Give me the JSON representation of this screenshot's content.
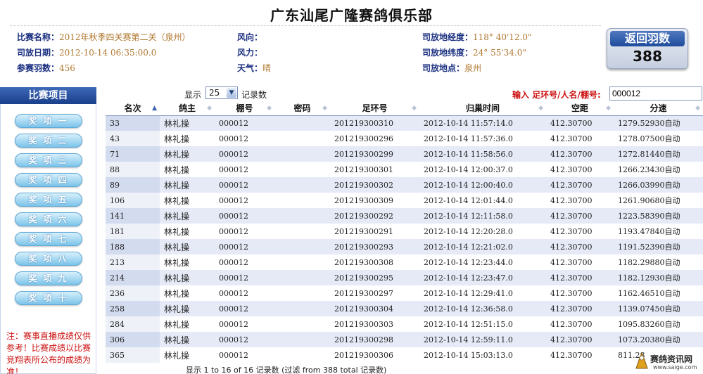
{
  "title": "广东汕尾广隆赛鸽俱乐部",
  "info": {
    "race_name_label": "比赛名称：",
    "race_name": "2012年秋季四关赛第二关（泉州）",
    "release_date_label": "司放日期：",
    "release_date": "2012-10-14 06:35:00.0",
    "entries_label": "参赛羽数：",
    "entries": "456",
    "wind_dir_label": "风向：",
    "wind_dir": "",
    "wind_force_label": "风力：",
    "wind_force": "",
    "weather_label": "天气：",
    "weather": "晴",
    "longitude_label": "司放地经度：",
    "longitude": "118° 40'12.0\"",
    "latitude_label": "司放地纬度：",
    "latitude": "24° 55'34.0\"",
    "location_label": "司放地点：",
    "location": "泉州"
  },
  "return_box": {
    "label": "返回羽数",
    "count": "388"
  },
  "sidebar": {
    "title": "比赛项目",
    "buttons": [
      "奖项一",
      "奖项二",
      "奖项三",
      "奖项四",
      "奖项五",
      "奖项六",
      "奖项七",
      "奖项八",
      "奖项九",
      "奖项十"
    ],
    "note": "注：赛事直播成绩仅供参考！比赛成绩以比赛竞翔表所公布的成绩为准！"
  },
  "controls": {
    "show_label": "显示",
    "page_size": "25",
    "records_label": "记录数",
    "search_label": "输入 足环号/人名/棚号:",
    "search_value": "000012"
  },
  "table": {
    "columns": [
      "名次",
      "鸽主",
      "棚号",
      "密码",
      "足环号",
      "归巢时间",
      "空距",
      "分速"
    ],
    "rows": [
      [
        "33",
        "林礼操",
        "000012",
        "",
        "201219300310",
        "2012-10-14 11:57:14.0",
        "412.30700",
        "1279.52930自动"
      ],
      [
        "43",
        "林礼操",
        "000012",
        "",
        "201219300296",
        "2012-10-14 11:57:36.0",
        "412.30700",
        "1278.07500自动"
      ],
      [
        "71",
        "林礼操",
        "000012",
        "",
        "201219300299",
        "2012-10-14 11:58:56.0",
        "412.30700",
        "1272.81440自动"
      ],
      [
        "88",
        "林礼操",
        "000012",
        "",
        "201219300301",
        "2012-10-14 12:00:37.0",
        "412.30700",
        "1266.23430自动"
      ],
      [
        "89",
        "林礼操",
        "000012",
        "",
        "201219300302",
        "2012-10-14 12:00:40.0",
        "412.30700",
        "1266.03990自动"
      ],
      [
        "106",
        "林礼操",
        "000012",
        "",
        "201219300309",
        "2012-10-14 12:01:44.0",
        "412.30700",
        "1261.90680自动"
      ],
      [
        "141",
        "林礼操",
        "000012",
        "",
        "201219300292",
        "2012-10-14 12:11:58.0",
        "412.30700",
        "1223.58390自动"
      ],
      [
        "181",
        "林礼操",
        "000012",
        "",
        "201219300291",
        "2012-10-14 12:20:28.0",
        "412.30700",
        "1193.47840自动"
      ],
      [
        "188",
        "林礼操",
        "000012",
        "",
        "201219300293",
        "2012-10-14 12:21:02.0",
        "412.30700",
        "1191.52390自动"
      ],
      [
        "213",
        "林礼操",
        "000012",
        "",
        "201219300308",
        "2012-10-14 12:23:44.0",
        "412.30700",
        "1182.29880自动"
      ],
      [
        "214",
        "林礼操",
        "000012",
        "",
        "201219300295",
        "2012-10-14 12:23:47.0",
        "412.30700",
        "1182.12930自动"
      ],
      [
        "236",
        "林礼操",
        "000012",
        "",
        "201219300297",
        "2012-10-14 12:29:41.0",
        "412.30700",
        "1162.46510自动"
      ],
      [
        "258",
        "林礼操",
        "000012",
        "",
        "201219300304",
        "2012-10-14 12:36:58.0",
        "412.30700",
        "1139.07450自动"
      ],
      [
        "284",
        "林礼操",
        "000012",
        "",
        "201219300303",
        "2012-10-14 12:51:15.0",
        "412.30700",
        "1095.83260自动"
      ],
      [
        "306",
        "林礼操",
        "000012",
        "",
        "201219300298",
        "2012-10-14 12:59:11.0",
        "412.30700",
        "1073.20380自动"
      ],
      [
        "365",
        "林礼操",
        "000012",
        "",
        "201219300306",
        "2012-10-14 15:03:13.0",
        "412.30700",
        "811.28"
      ]
    ],
    "info": "显示 1 to 16 of 16 记录数 (过滤 from 388 total 记录数)"
  },
  "watermark": {
    "main": "赛鸽资讯网",
    "sub": "www.saige.com"
  },
  "colors": {
    "label_blue": "#1a2f80",
    "value_orange": "#b07830",
    "row_stripe": "#e5eaf6",
    "note_red": "#cc1111"
  }
}
